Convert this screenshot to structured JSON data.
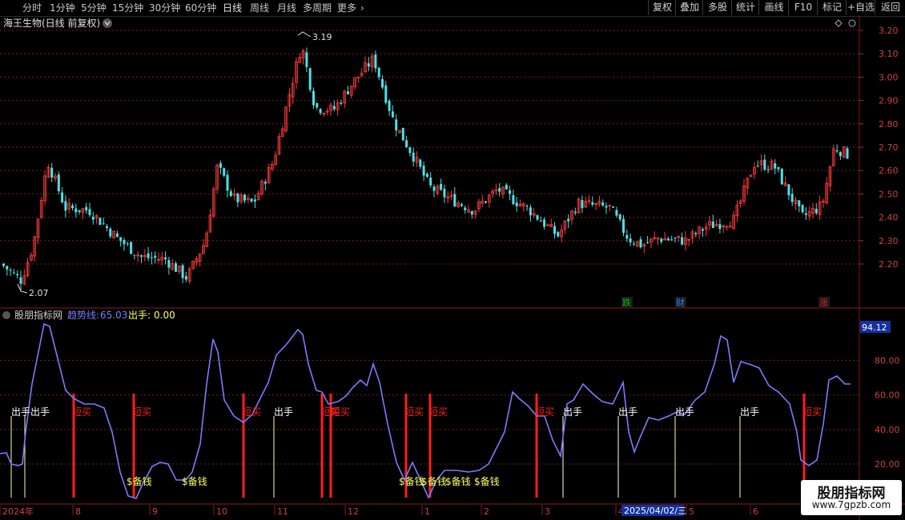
{
  "toolbar": {
    "tabs": [
      "分时",
      "1分钟",
      "5分钟",
      "15分钟",
      "30分钟",
      "60分钟",
      "日线",
      "周线",
      "月线",
      "多周期",
      "更多"
    ],
    "active_tab": "日线",
    "right_buttons": [
      "复权",
      "叠加",
      "多股",
      "统计",
      "画线",
      "F10",
      "标记",
      "+自选",
      "返回"
    ]
  },
  "main_panel": {
    "title": "海王生物(日线 前复权)",
    "high_label": "3.19",
    "low_label": "2.07",
    "price_ticks": [
      "3.20",
      "3.10",
      "3.00",
      "2.90",
      "2.80",
      "2.70",
      "2.60",
      "2.50",
      "2.40",
      "2.30",
      "2.20"
    ],
    "event_tags": [
      {
        "text": "跌",
        "color": "#00c000"
      },
      {
        "text": "财",
        "color": "#3a7cff"
      },
      {
        "text": "涨",
        "color": "#d02020"
      }
    ]
  },
  "indicator_panel": {
    "name": "股朋指标网",
    "trend_label": "趋势线:",
    "trend_value": "65.03",
    "exit_label": "出手:",
    "exit_value": "0.00",
    "current_value": "94.12",
    "ticks": [
      "80.00",
      "60.00",
      "40.00",
      "20.00"
    ],
    "signal_labels": {
      "exit": "出手",
      "buy": "短买",
      "reserve": "$备钱"
    }
  },
  "date_axis": {
    "labels": [
      "2024年",
      "8",
      "9",
      "10",
      "11",
      "12",
      "1",
      "2",
      "3",
      "4",
      "5",
      "6"
    ],
    "cursor_date": "2025/04/02/三"
  },
  "watermark": {
    "title": "股朋指标网",
    "url": "www.7gpzb.com"
  },
  "colors": {
    "up": "#ff3b3b",
    "down": "#4fe0e6",
    "trend": "#7b7bff",
    "signal_red": "#ff1e1e",
    "grid": "#7a1c1c"
  }
}
